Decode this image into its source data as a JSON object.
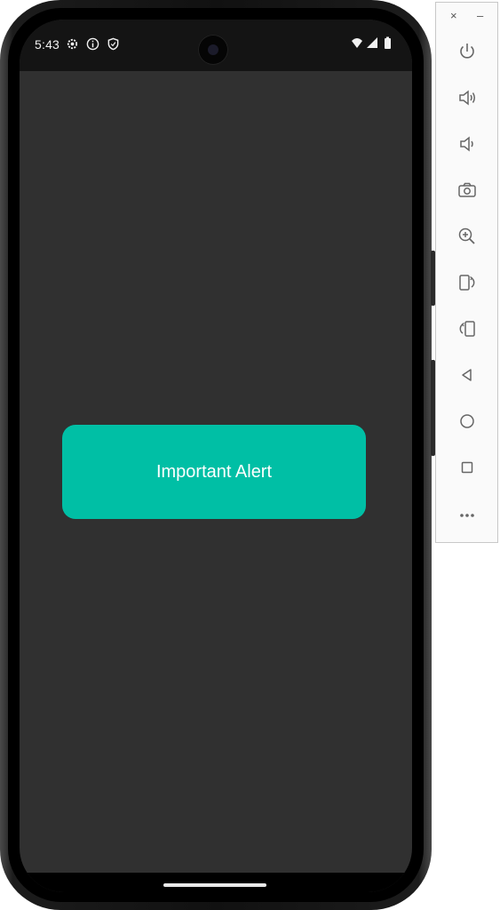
{
  "status_bar": {
    "time": "5:43",
    "left_icons": [
      "gear-icon",
      "info-icon",
      "shield-icon"
    ],
    "right_icons": [
      "wifi-icon",
      "signal-icon",
      "battery-icon"
    ]
  },
  "app": {
    "button_label": "Important Alert",
    "button_color": "#00bfa5",
    "background_color": "#303030"
  },
  "toolbar": {
    "close_label": "×",
    "minimize_label": "–",
    "buttons": [
      "power-icon",
      "volume-up-icon",
      "volume-down-icon",
      "camera-icon",
      "zoom-icon",
      "rotate-left-icon",
      "rotate-right-icon",
      "back-icon",
      "home-icon",
      "overview-icon",
      "more-icon"
    ]
  }
}
